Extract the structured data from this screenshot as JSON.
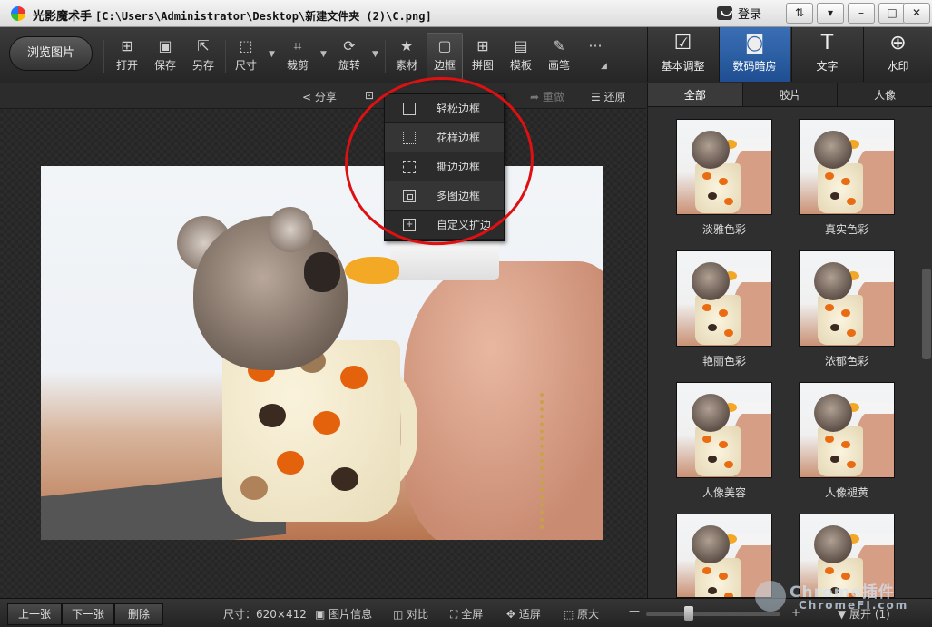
{
  "titlebar": {
    "app_name": "光影魔术手",
    "file_path": "[C:\\Users\\Administrator\\Desktop\\新建文件夹 (2)\\C.png]",
    "login_label": "登录",
    "icons": [
      "pin-icon",
      "dropdown-icon",
      "minimize-icon",
      "maximize-icon",
      "close-icon"
    ]
  },
  "toolbar": {
    "browse_label": "浏览图片",
    "tools": [
      {
        "label": "打开",
        "icon": "open-icon"
      },
      {
        "label": "保存",
        "icon": "save-icon"
      },
      {
        "label": "另存",
        "icon": "save-as-icon"
      },
      {
        "label": "尺寸",
        "icon": "resize-icon"
      },
      {
        "label": "裁剪",
        "icon": "crop-icon"
      },
      {
        "label": "旋转",
        "icon": "rotate-icon"
      },
      {
        "label": "素材",
        "icon": "material-icon"
      },
      {
        "label": "边框",
        "icon": "border-icon",
        "active": true
      },
      {
        "label": "拼图",
        "icon": "collage-icon"
      },
      {
        "label": "模板",
        "icon": "template-icon"
      },
      {
        "label": "画笔",
        "icon": "brush-icon"
      },
      {
        "label": "···",
        "icon": "more-icon"
      }
    ],
    "right_tabs": [
      {
        "label": "基本调整",
        "icon": "basic-adjust-icon"
      },
      {
        "label": "数码暗房",
        "icon": "darkroom-icon",
        "active": true
      },
      {
        "label": "文字",
        "icon": "text-icon"
      },
      {
        "label": "水印",
        "icon": "watermark-icon"
      }
    ]
  },
  "subbar": {
    "share_label": "分享",
    "redo_label": "重做",
    "restore_label": "还原"
  },
  "border_menu": {
    "items": [
      "轻松边框",
      "花样边框",
      "撕边边框",
      "多图边框",
      "自定义扩边"
    ]
  },
  "panel": {
    "tabs": [
      "全部",
      "胶片",
      "人像"
    ],
    "thumbnails": [
      "淡雅色彩",
      "真实色彩",
      "艳丽色彩",
      "浓郁色彩",
      "人像美容",
      "人像褪黄",
      "",
      ""
    ]
  },
  "statusbar": {
    "prev_label": "上一张",
    "next_label": "下一张",
    "delete_label": "删除",
    "size_label": "尺寸：620×412",
    "info_label": "图片信息",
    "compare_label": "对比",
    "fullscreen_label": "全屏",
    "fit_label": "适屏",
    "original_label": "原大",
    "expand_label": "展开 (1)"
  },
  "watermark": {
    "line1": "Chrome插件",
    "line2": "ChromeFI.com"
  }
}
